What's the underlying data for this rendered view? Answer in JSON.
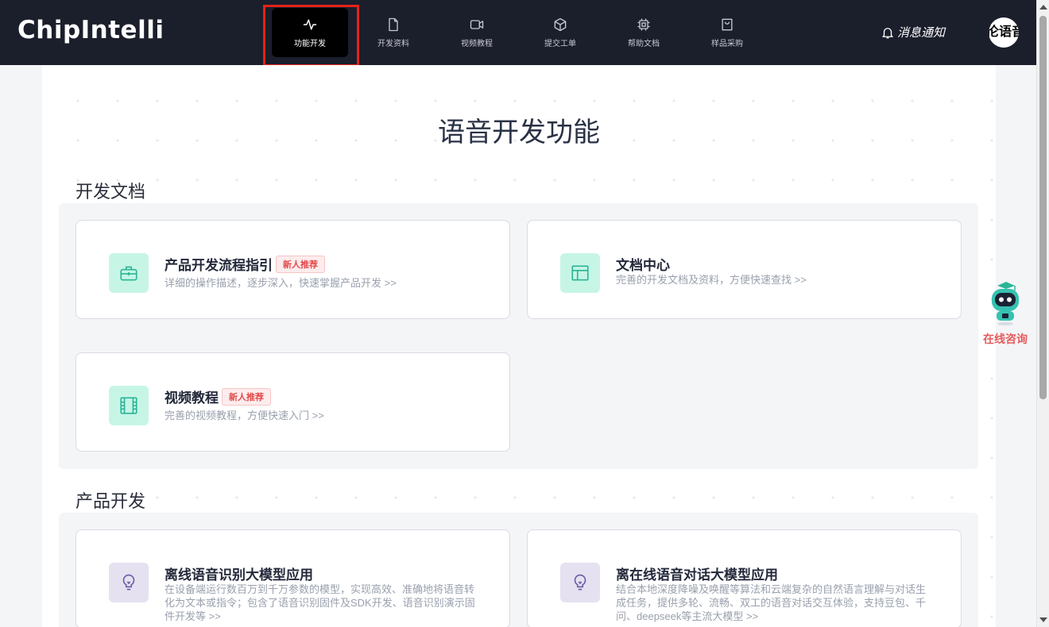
{
  "header": {
    "logo": "ChipIntelli",
    "nav": [
      {
        "label": "功能开发",
        "icon": "activity-icon",
        "active": true
      },
      {
        "label": "开发资料",
        "icon": "document-icon"
      },
      {
        "label": "视频教程",
        "icon": "video-icon"
      },
      {
        "label": "提交工单",
        "icon": "cube-icon"
      },
      {
        "label": "帮助文档",
        "icon": "chip-icon"
      },
      {
        "label": "样品采购",
        "icon": "shopping-bag-icon"
      }
    ],
    "notify_label": "消息通知",
    "avatar_text": "伦语音"
  },
  "page": {
    "title": "语音开发功能"
  },
  "sections": [
    {
      "title": "开发文档",
      "cards": [
        {
          "title": "产品开发流程指引",
          "badge": "新人推荐",
          "desc": "详细的操作描述，逐步深入，快速掌握产品开发 >>",
          "icon": "toolbox-icon"
        },
        {
          "title": "文档中心",
          "badge": "",
          "desc": "完善的开发文档及资料，方便快速查找 >>",
          "icon": "layout-icon"
        },
        {
          "title": "视频教程",
          "badge": "新人推荐",
          "desc": "完善的视频教程，方便快速入门 >>",
          "icon": "film-icon"
        }
      ]
    },
    {
      "title": "产品开发",
      "cards": [
        {
          "title": "离线语音识别大模型应用",
          "badge": "",
          "desc": "在设备端运行数百万到千万参数的模型，实现高效、准确地将语音转化为文本或指令；包含了语音识别固件及SDK开发、语音识别演示固件开发等 >>",
          "icon": "lightbulb-icon"
        },
        {
          "title": "离在线语音对话大模型应用",
          "badge": "",
          "desc": "结合本地深度降噪及唤醒等算法和云端复杂的自然语言理解与对话生成任务，提供多轮、流畅、双工的语音对话交互体验，支持豆包、千问、deepseek等主流大模型 >>",
          "icon": "lightbulb-icon"
        }
      ]
    }
  ],
  "consult": {
    "label": "在线咨询"
  },
  "colors": {
    "header_bg": "#1b1e2b",
    "active_nav_bg": "#000000",
    "highlight_border": "#e2231a",
    "badge_text": "#e24a4a",
    "icon_green_bg": "#c6f5e6",
    "icon_purple_bg": "#e5e1f0",
    "consult_text": "#e55c5c"
  }
}
